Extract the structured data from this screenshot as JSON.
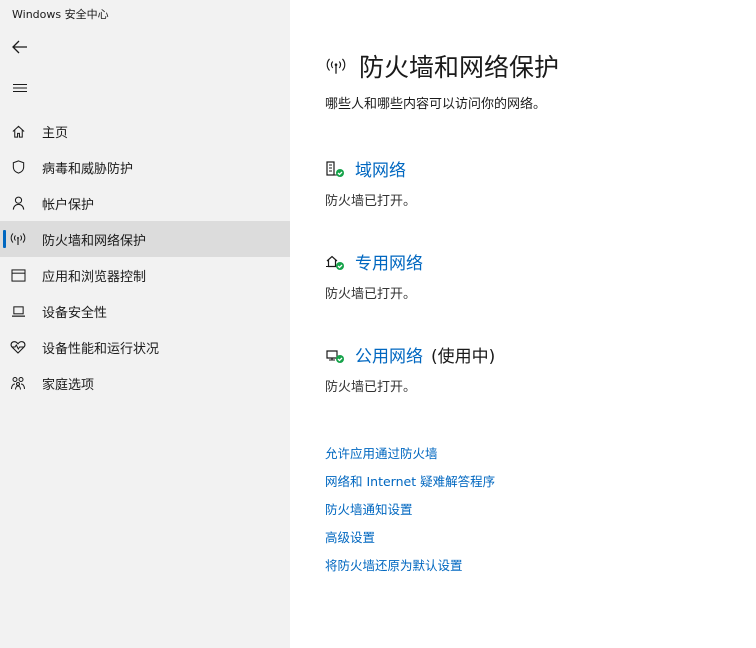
{
  "window": {
    "title": "Windows 安全中心"
  },
  "sidebar": {
    "items": [
      {
        "label": "主页",
        "icon": "home-icon"
      },
      {
        "label": "病毒和威胁防护",
        "icon": "shield-icon"
      },
      {
        "label": "帐户保护",
        "icon": "person-icon"
      },
      {
        "label": "防火墙和网络保护",
        "icon": "wifi-signal-icon",
        "active": true
      },
      {
        "label": "应用和浏览器控制",
        "icon": "app-window-icon"
      },
      {
        "label": "设备安全性",
        "icon": "laptop-icon"
      },
      {
        "label": "设备性能和运行状况",
        "icon": "heart-pulse-icon"
      },
      {
        "label": "家庭选项",
        "icon": "family-icon"
      }
    ]
  },
  "main": {
    "title": "防火墙和网络保护",
    "subtitle": "哪些人和哪些内容可以访问你的网络。",
    "networks": [
      {
        "name": "域网络",
        "suffix": "",
        "status": "防火墙已打开。",
        "icon": "domain-network-icon"
      },
      {
        "name": "专用网络",
        "suffix": "",
        "status": "防火墙已打开。",
        "icon": "private-network-icon"
      },
      {
        "name": "公用网络",
        "suffix": "(使用中)",
        "status": "防火墙已打开。",
        "icon": "public-network-icon"
      }
    ],
    "links": [
      "允许应用通过防火墙",
      "网络和 Internet 疑难解答程序",
      "防火墙通知设置",
      "高级设置",
      "将防火墙还原为默认设置"
    ]
  },
  "colors": {
    "accent": "#0067c0",
    "ok": "#16a34a",
    "sidebar_bg": "#f2f2f2",
    "active_bg": "#dcdcdc"
  }
}
